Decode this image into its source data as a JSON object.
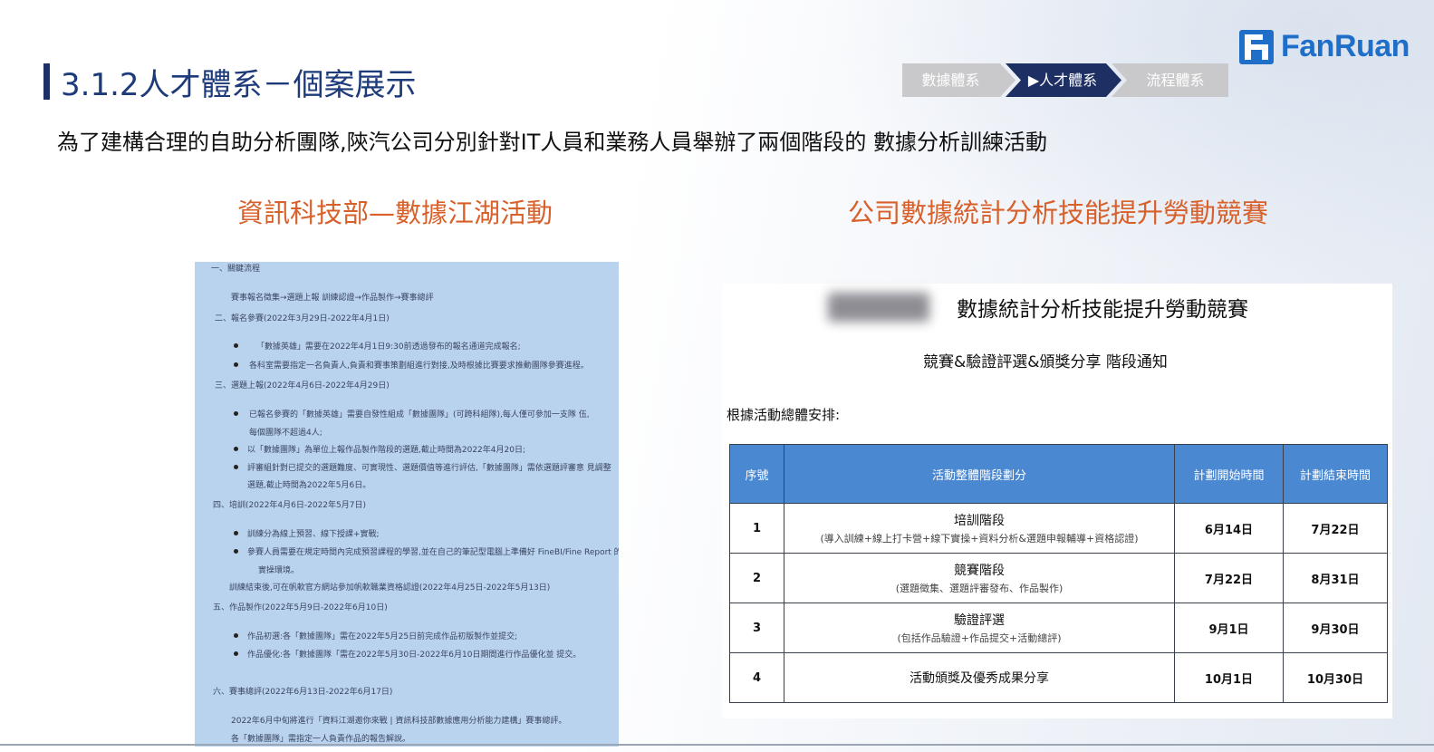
{
  "header": {
    "title": "3.1.2人才體系－個案展示",
    "logo_text": "FanRuan",
    "steps": [
      "數據體系",
      "▶人才體系",
      "流程體系"
    ],
    "accent_color": "#1d2f63",
    "logo_color": "#1f6fc9"
  },
  "intro": "為了建構合理的自助分析團隊,陝汽公司分別針對IT人員和業務人員舉辦了兩個階段的 數據分析訓練活動",
  "left_section": {
    "subtitle": "資訊科技部—數據江湖活動",
    "doc_lines": [
      "一、關鍵流程",
      "賽事報名徵集→選題上報 訓練認證→作品製作→賽事總評",
      "二、報名參賽(2022年3月29日-2022年4月1日)",
      "「數據英雄」需要在2022年4月1日9:30前透過發布的報名通道完成報名;",
      "各科室需要指定一名負責人,負責和賽事策劃組進行對接,及時根據比賽要求推動團隊參賽進程。",
      "三、選題上報(2022年4月6日-2022年4月29日)",
      "已報名參賽的「數據英雄」需要自發性組成「數據團隊」(可跨科組隊),每人僅可參加一支隊 伍,",
      "每個團隊不超過4人;",
      "以「數據團隊」為單位上報作品製作階段的選題,截止時間為2022年4月20日;",
      "評審組針對已提交的選題難度、可實現性、選題價值等進行評估,「數據團隊」需依選題評審意 見調整",
      "選題,截止時間為2022年5月6日。",
      "四、培訓(2022年4月6日-2022年5月7日)",
      "訓練分為線上預習、線下授課+實戰;",
      "參賽人員需要在規定時間內完成預習課程的學習,並在自己的筆記型電腦上準備好 FineBI/Fine Report 的",
      "實操環境。",
      "訓練結束後,可在帆軟官方網站參加帆軟職業資格認證(2022年4月25日-2022年5月13日)",
      "五、作品製作(2022年5月9日-2022年6月10日)",
      "作品初選:各「數據團隊」需在2022年5月25日前完成作品初版製作並提交;",
      "作品優化:各「數據團隊「需在2022年5月30日-2022年6月10日期間進行作品優化並 提交。",
      "六、賽事總評(2022年6月13日-2022年6月17日)",
      "2022年6月中旬將進行「資料江湖邀你來戰 | 資訊科技部數據應用分析能力建構」賽事總評。",
      "各「數據團隊」需指定一人負責作品的報告解說。"
    ]
  },
  "right_section": {
    "subtitle": "公司數據統計分析技能提升勞動競賽",
    "doc_title": "數據統計分析技能提升勞動競賽",
    "doc_subtitle": "競賽&驗證評選&頒獎分享 階段通知",
    "doc_note": "根據活動總體安排:",
    "table": {
      "headers": [
        "序號",
        "活動整體階段劃分",
        "計劃開始時間",
        "計劃結束時間"
      ],
      "rows": [
        {
          "no": "1",
          "stage": "培訓階段",
          "detail": "(導入訓練+線上打卡營+線下實操+資料分析&選題申報輔導+資格認證)",
          "start": "6月14日",
          "end": "7月22日"
        },
        {
          "no": "2",
          "stage": "競賽階段",
          "detail": "(選題徵集、選題評審發布、作品製作)",
          "start": "7月22日",
          "end": "8月31日"
        },
        {
          "no": "3",
          "stage": "驗證評選",
          "detail": "(包括作品驗證+作品提交+活動總評)",
          "start": "9月1日",
          "end": "9月30日"
        },
        {
          "no": "4",
          "stage": "活動頒獎及優秀成果分享",
          "detail": "",
          "start": "10月1日",
          "end": "10月30日"
        }
      ],
      "header_color": "#4a88d2"
    }
  },
  "subtitle_color": "#d8602b"
}
